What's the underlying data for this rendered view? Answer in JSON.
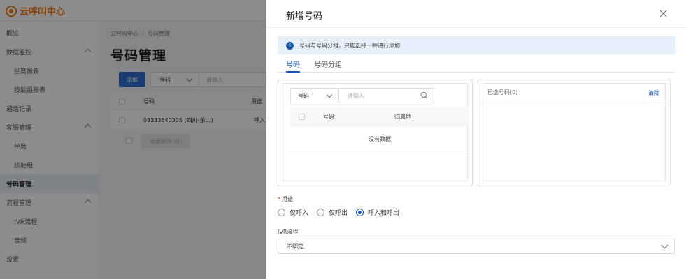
{
  "app": {
    "logo_text": "云呼叫中心"
  },
  "sidebar": {
    "items": [
      {
        "label": "概览"
      },
      {
        "label": "数据监控"
      },
      {
        "label": "坐席报表"
      },
      {
        "label": "技能组报表"
      },
      {
        "label": "通话记录"
      },
      {
        "label": "客服管理"
      },
      {
        "label": "坐席"
      },
      {
        "label": "技能组"
      },
      {
        "label": "号码管理"
      },
      {
        "label": "流程管理"
      },
      {
        "label": "IVR流程"
      },
      {
        "label": "音频"
      },
      {
        "label": "设置"
      }
    ],
    "collapse_glyph": "‹"
  },
  "main": {
    "breadcrumb": [
      "云呼叫中心",
      "/",
      "号码管理"
    ],
    "title": "号码管理",
    "add_label": "添加",
    "filter_select": "号码",
    "filter_placeholder": "请输入",
    "table": {
      "headers": [
        "号码",
        "用途"
      ],
      "rows": [
        {
          "number": "08333640305 (四川-乐山)",
          "usage": "呼入"
        }
      ]
    },
    "bulk_delete_label": "批量删除 (0)"
  },
  "drawer": {
    "title": "新增号码",
    "alert_icon": "i",
    "alert_text": "号码与号码分组，只能选择一种进行添加",
    "tabs": [
      {
        "label": "号码",
        "active": true
      },
      {
        "label": "号码分组",
        "active": false
      }
    ],
    "left": {
      "search_select": "号码",
      "search_placeholder": "请输入",
      "headers": [
        "号码",
        "归属地"
      ],
      "empty_text": "没有数据"
    },
    "right": {
      "selected_label": "已选号码(0)",
      "clear_label": "清除"
    },
    "purpose": {
      "required_mark": "*",
      "label": "用途",
      "options": [
        {
          "label": "仅呼入",
          "checked": false
        },
        {
          "label": "仅呼出",
          "checked": false
        },
        {
          "label": "呼入和呼出",
          "checked": true
        }
      ]
    },
    "ivr": {
      "label": "IVR流程",
      "value": "不绑定"
    }
  },
  "colors": {
    "brand": "#e8730c",
    "primary": "#1a55b5",
    "alert_bg": "#e6f0fb"
  }
}
